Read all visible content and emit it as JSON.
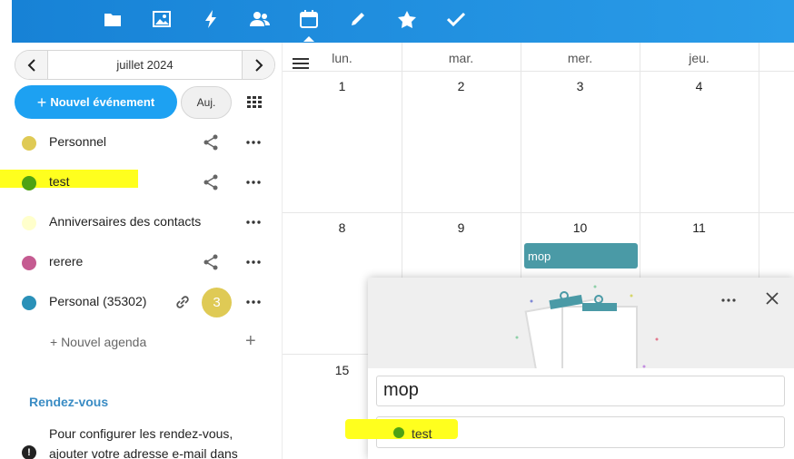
{
  "nav": {
    "apps": [
      {
        "icon": "folder-icon"
      },
      {
        "icon": "image-icon"
      },
      {
        "icon": "activity-icon"
      },
      {
        "icon": "contacts-icon"
      },
      {
        "icon": "calendar-icon",
        "active": true
      },
      {
        "icon": "pencil-icon"
      },
      {
        "icon": "star-icon"
      },
      {
        "icon": "check-icon"
      }
    ]
  },
  "sidebar": {
    "month": "juillet 2024",
    "new_event_label": "Nouvel événement",
    "today_label": "Auj.",
    "calendars": [
      {
        "label": "Personnel",
        "color": "#dfca55",
        "shared": true,
        "highlighted": false
      },
      {
        "label": "test",
        "color": "#4ea214",
        "shared": true,
        "highlighted": true
      },
      {
        "label": "Anniversaires des contacts",
        "color": "#ffffcc",
        "shared": false,
        "highlighted": false
      },
      {
        "label": "rerere",
        "color": "#c55b91",
        "shared": true,
        "highlighted": false
      },
      {
        "label": "Personal (35302)",
        "color": "#2a91b8",
        "shared": false,
        "link": true,
        "badge": "3",
        "highlighted": false
      }
    ],
    "new_calendar_label": "+ Nouvel agenda",
    "appointments_title": "Rendez-vous",
    "appointments_text": "Pour configurer les rendez-vous, ajouter votre adresse e-mail dans"
  },
  "calendar": {
    "days": [
      "lun.",
      "mar.",
      "mer.",
      "jeu."
    ],
    "weeks": [
      [
        "1",
        "2",
        "3",
        "4"
      ],
      [
        "8",
        "9",
        "10",
        "11"
      ],
      [
        "15"
      ]
    ],
    "event": {
      "title": "mop",
      "color": "#4a9aa6"
    }
  },
  "popover": {
    "title_value": "mop",
    "calendar_value": "test",
    "calendar_color": "#4ea214"
  }
}
